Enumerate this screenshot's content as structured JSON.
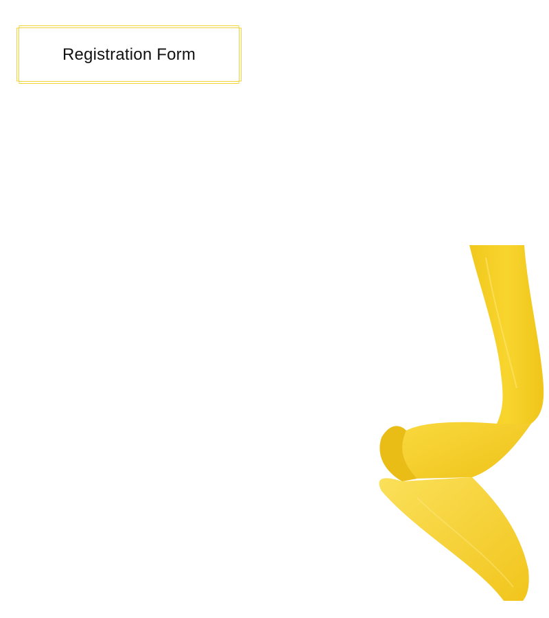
{
  "header": {
    "title": "Registration Form"
  },
  "decoration": {
    "ribbon_icon": "yellow-ribbon",
    "frame_color": "#f2d33b",
    "ribbon_color": "#f7d12a",
    "ribbon_shadow": "#e2b914",
    "ribbon_highlight": "#fbe05a"
  }
}
